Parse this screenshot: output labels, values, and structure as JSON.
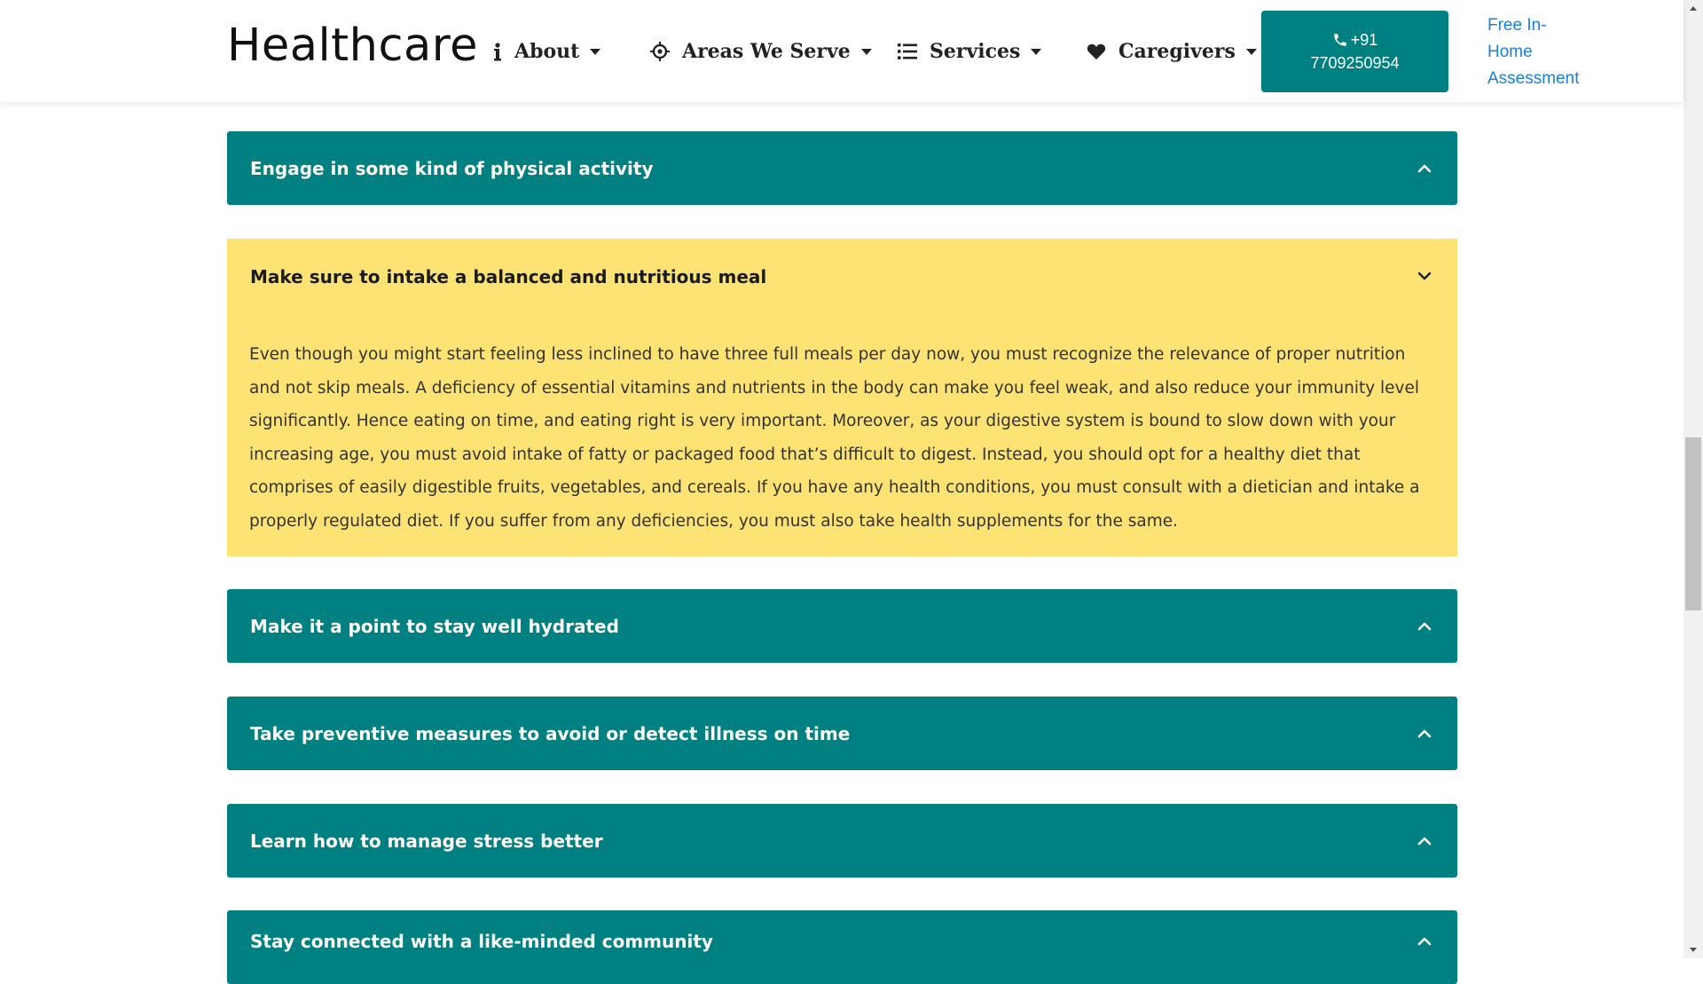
{
  "header": {
    "brand": "Healthcare",
    "nav": [
      {
        "label": "About",
        "icon": "info-icon"
      },
      {
        "label": "Areas We Serve",
        "icon": "crosshair-icon"
      },
      {
        "label": "Services",
        "icon": "list-icon"
      },
      {
        "label": "Caregivers",
        "icon": "heart-icon"
      }
    ],
    "call_button": {
      "line1": "+91",
      "line2": "7709250954",
      "icon": "phone-icon"
    },
    "assessment_link": {
      "line1": "Free In-",
      "line2": "Home",
      "line3": "Assessment"
    }
  },
  "accordion": [
    {
      "title": "Engage in some kind of physical activity",
      "expanded": false
    },
    {
      "title": "Make sure to intake a balanced and nutritious meal",
      "expanded": true,
      "body": "Even though you might start feeling less inclined to have three full meals per day now, you must recognize the relevance of proper nutrition and not skip meals. A deficiency of essential vitamins and nutrients in the body can make you feel weak, and also reduce your immunity level significantly. Hence eating on time, and eating right is very important. Moreover, as your digestive system is bound to slow down with your increasing age, you must avoid intake of fatty or packaged food that’s difficult to digest. Instead, you should opt for a healthy diet that comprises of easily digestible fruits, vegetables, and cereals. If you have any health conditions, you must consult with a dietician and intake a properly regulated diet. If you suffer from any deficiencies, you must also take health supplements for the same."
    },
    {
      "title": "Make it a point to stay well hydrated",
      "expanded": false
    },
    {
      "title": "Take preventive measures to avoid or detect illness on time",
      "expanded": false
    },
    {
      "title": "Learn how to manage stress better",
      "expanded": false
    },
    {
      "title": "Stay connected with a like-minded community",
      "expanded": false
    }
  ],
  "colors": {
    "teal": "#008080",
    "highlight": "#fde274",
    "link": "#1a7fe0"
  }
}
